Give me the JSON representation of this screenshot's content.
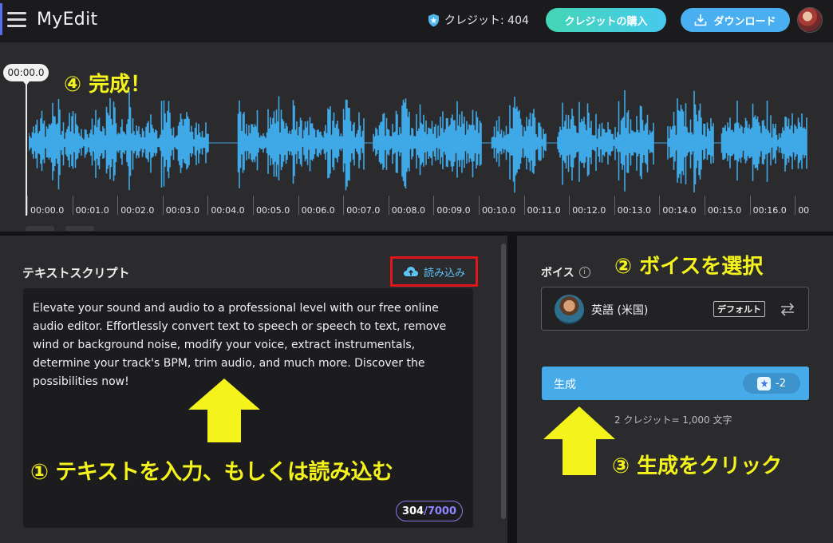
{
  "header": {
    "app_title": "MyEdit",
    "credits_label": "クレジット: 404",
    "buy_credits_label": "クレジットの購入",
    "download_label": "ダウンロード"
  },
  "waveform": {
    "playhead_time": "00:00.0",
    "ticks": [
      "00:00.0",
      "00:01.0",
      "00:02.0",
      "00:03.0",
      "00:04.0",
      "00:05.0",
      "00:06.0",
      "00:07.0",
      "00:08.0",
      "00:09.0",
      "00:10.0",
      "00:11.0",
      "00:12.0",
      "00:13.0",
      "00:14.0",
      "00:15.0",
      "00:16.0",
      "00"
    ],
    "wave_color": "#3fa8e6"
  },
  "script": {
    "title": "テキストスクリプト",
    "upload_label": "読み込み",
    "text": "Elevate your sound and audio to a professional level with our free online audio editor. Effortlessly convert text to speech or speech to text, remove wind or background noise, modify your voice, extract instrumentals, determine your track's BPM, trim audio, and much more. Discover the possibilities now!",
    "count_current": "304",
    "count_separator": "/",
    "count_max": "7000"
  },
  "voice": {
    "label": "ボイス",
    "info_icon": "i",
    "selected_voice": "英語 (米国)",
    "default_badge": "デフォルト",
    "generate_label": "生成",
    "generate_cost": "-2",
    "credit_note": "2 クレジット= 1,000 文字"
  },
  "annotations": {
    "step1": "① テキストを入力、もしくは読み込む",
    "step2": "② ボイスを選択",
    "step3": "③ 生成をクリック",
    "step4": "④ 完成！",
    "highlight_color": "#f4f41c",
    "box_color": "#e3141b"
  }
}
